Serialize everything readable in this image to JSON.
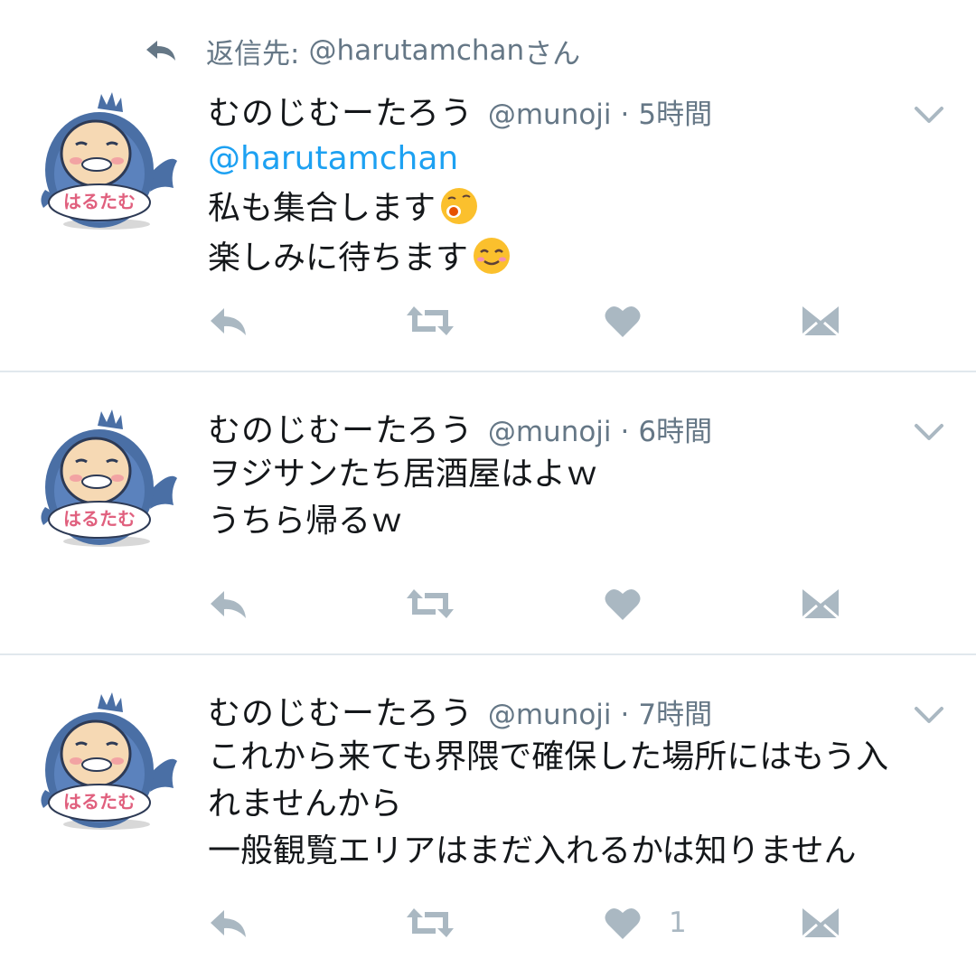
{
  "reply_context": {
    "prefix": "返信先: ",
    "handle": "@harutamchan",
    "suffix": "さん"
  },
  "avatar_label": "はるたむ",
  "tweets": [
    {
      "name": "むのじむーたろう",
      "handle": "@munoji",
      "dot": "·",
      "time": "5時間",
      "mention": "@harutamchan",
      "lines": [
        "私も集合します",
        "楽しみに待ちます"
      ],
      "emojis": [
        "sleepy-face-emoji",
        "smiling-face-emoji"
      ],
      "likes": ""
    },
    {
      "name": "むのじむーたろう",
      "handle": "@munoji",
      "dot": "·",
      "time": "6時間",
      "lines": [
        "ヲジサンたち居酒屋はよｗ",
        "うちら帰るｗ"
      ],
      "likes": ""
    },
    {
      "name": "むのじむーたろう",
      "handle": "@munoji",
      "dot": "·",
      "time": "7時間",
      "lines": [
        "これから来ても界隈で確保した場所にはもう入",
        "れませんから",
        "一般観覧エリアはまだ入れるかは知りません"
      ],
      "likes": "1"
    }
  ],
  "icons": {
    "reply": "reply-icon",
    "retweet": "retweet-icon",
    "like": "heart-icon",
    "dm": "envelope-icon",
    "menu": "chevron-down-icon"
  },
  "colors": {
    "icon_gray": "#aab8c2",
    "secondary_text": "#657786",
    "link_blue": "#1da1f2",
    "divider": "#e1e8ed"
  }
}
